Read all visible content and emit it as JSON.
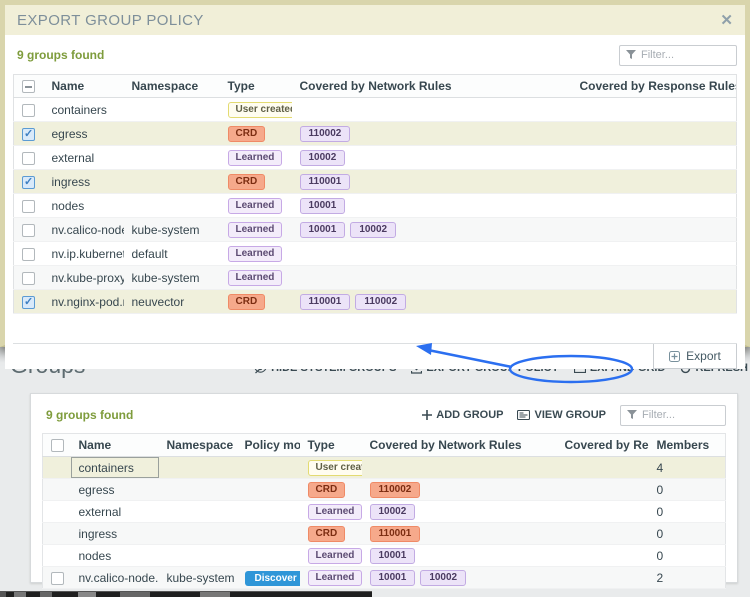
{
  "colors": {
    "annotation_blue": "#2b6ff0",
    "modal_header_beige": "#f1efd8",
    "selected_row_beige": "#f0f0dc",
    "olive_green_text": "#7e9c3c",
    "crd_badge_orange": "#f6a98b",
    "learned_badge_purple": "#f3ecfa",
    "discover_badge_blue": "#2f96d8"
  },
  "modal": {
    "title": "EXPORT GROUP POLICY",
    "close_icon": "close-icon",
    "groups_found": "9 groups found",
    "filter_placeholder": "Filter...",
    "export_button": "Export",
    "table": {
      "headers": [
        "Name",
        "Namespace",
        "Type",
        "Covered by Network Rules",
        "Covered by Response Rules"
      ],
      "rows": [
        {
          "name": "containers",
          "namespace": "",
          "type": "User created",
          "type_key": "user",
          "rules": [],
          "selected": false
        },
        {
          "name": "egress",
          "namespace": "",
          "type": "CRD",
          "type_key": "crd",
          "rules": [
            "110002"
          ],
          "selected": true
        },
        {
          "name": "external",
          "namespace": "",
          "type": "Learned",
          "type_key": "learned",
          "rules": [
            "10002"
          ],
          "selected": false
        },
        {
          "name": "ingress",
          "namespace": "",
          "type": "CRD",
          "type_key": "crd",
          "rules": [
            "110001"
          ],
          "selected": true
        },
        {
          "name": "nodes",
          "namespace": "",
          "type": "Learned",
          "type_key": "learned",
          "rules": [
            "10001"
          ],
          "selected": false
        },
        {
          "name": "nv.calico-node.kub",
          "namespace": "kube-system",
          "type": "Learned",
          "type_key": "learned",
          "rules": [
            "10001",
            "10002"
          ],
          "selected": false
        },
        {
          "name": "nv.ip.kubernetes.d",
          "namespace": "default",
          "type": "Learned",
          "type_key": "learned",
          "rules": [],
          "selected": false
        },
        {
          "name": "nv.kube-proxy.kub",
          "namespace": "kube-system",
          "type": "Learned",
          "type_key": "learned",
          "rules": [],
          "selected": false
        },
        {
          "name": "nv.nginx-pod.neuv",
          "namespace": "neuvector",
          "type": "CRD",
          "type_key": "crd",
          "rules": [
            "110001",
            "110002"
          ],
          "selected": true
        }
      ]
    }
  },
  "page": {
    "title": "Groups",
    "toolbar": {
      "hide_system_groups": "HIDE SYSTEM GROUPS",
      "export_group_policy": "EXPORT GROUP POLICY",
      "expand_grid": "EXPAND GRID",
      "refresh": "REFRESH"
    },
    "card": {
      "groups_found": "9 groups found",
      "add_group": "ADD GROUP",
      "view_group": "VIEW GROUP",
      "filter_placeholder": "Filter...",
      "table": {
        "headers": [
          "Name",
          "Namespace",
          "Policy mode",
          "Type",
          "Covered by Network Rules",
          "Covered by Response R...",
          "Members"
        ],
        "rows": [
          {
            "name": "containers",
            "namespace": "",
            "policy_mode": "",
            "type": "User created",
            "type_key": "user",
            "rules": [],
            "members": "4",
            "selected": true
          },
          {
            "name": "egress",
            "namespace": "",
            "policy_mode": "",
            "type": "CRD",
            "type_key": "crd",
            "rules": [
              "110002"
            ],
            "members": "0",
            "selected": false
          },
          {
            "name": "external",
            "namespace": "",
            "policy_mode": "",
            "type": "Learned",
            "type_key": "learned",
            "rules": [
              "10002"
            ],
            "members": "0",
            "selected": false
          },
          {
            "name": "ingress",
            "namespace": "",
            "policy_mode": "",
            "type": "CRD",
            "type_key": "crd",
            "rules": [
              "110001"
            ],
            "members": "0",
            "selected": false
          },
          {
            "name": "nodes",
            "namespace": "",
            "policy_mode": "",
            "type": "Learned",
            "type_key": "learned",
            "rules": [
              "10001"
            ],
            "members": "0",
            "selected": false
          },
          {
            "name": "nv.calico-node.kube-sys",
            "namespace": "kube-system",
            "policy_mode": "Discover",
            "type": "Learned",
            "type_key": "learned",
            "rules": [
              "10001",
              "10002"
            ],
            "members": "2",
            "selected": false
          }
        ]
      }
    }
  }
}
